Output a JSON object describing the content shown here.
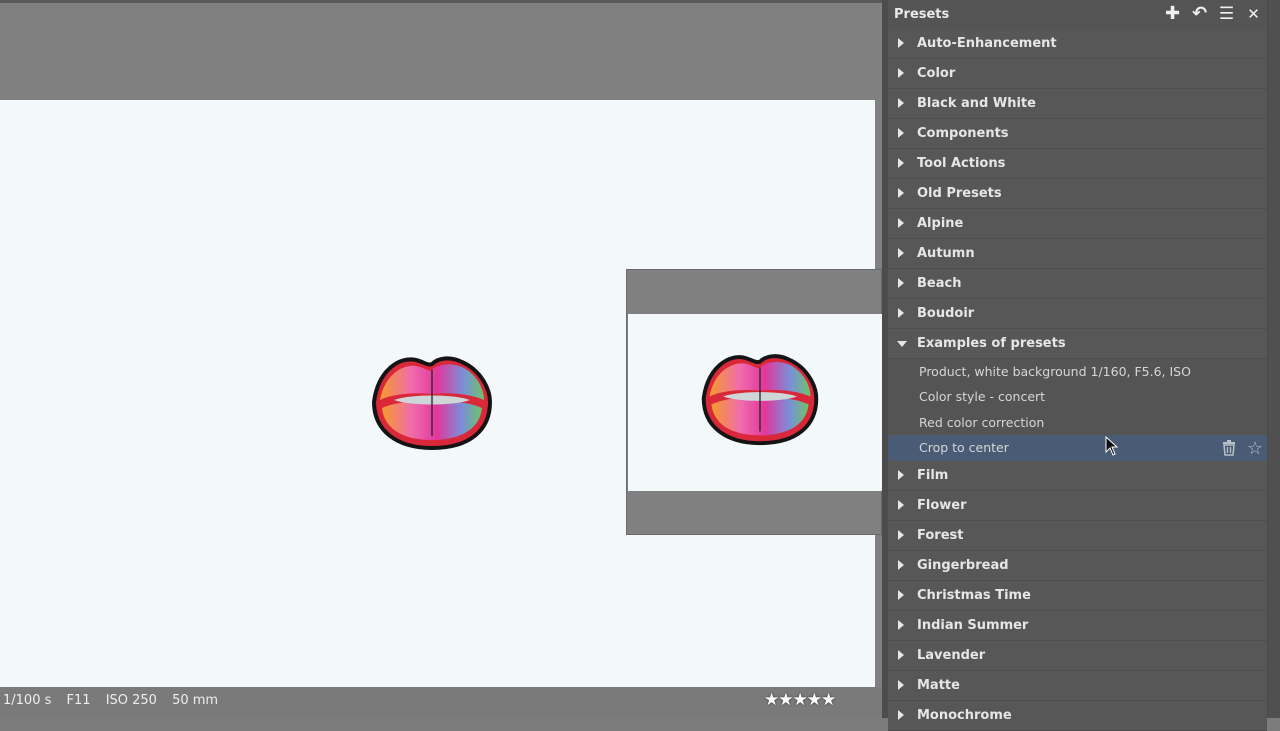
{
  "status": {
    "exif": [
      "1/100 s",
      "F11",
      "ISO 250",
      "50 mm"
    ],
    "rating": 5,
    "stars": "★★★★★"
  },
  "panel": {
    "title": "Presets",
    "icons": {
      "add": "plus-icon",
      "undo": "undo-icon",
      "menu": "menu-icon",
      "close": "close-icon"
    },
    "glyphs": {
      "add": "✚",
      "undo": "↶",
      "menu": "☰",
      "close": "✕",
      "delete": "🗑",
      "favorite": "☆"
    },
    "categories_before": [
      "Auto-Enhancement",
      "Color",
      "Black and White",
      "Components",
      "Tool Actions",
      "Old Presets",
      "Alpine",
      "Autumn",
      "Beach",
      "Boudoir"
    ],
    "open_category": "Examples of presets",
    "presets": [
      "Product, white background 1/160, F5.6, ISO",
      "Color style - concert",
      "Red color correction",
      "Crop to center"
    ],
    "selected_preset": "Crop to center",
    "categories_after": [
      "Film",
      "Flower",
      "Forest",
      "Gingerbread",
      "Christmas Time",
      "Indian Summer",
      "Lavender",
      "Matte",
      "Monochrome"
    ]
  },
  "colors": {
    "selection": "#4a5b75",
    "panel_bg": "#545454",
    "canvas_bg": "#808080"
  }
}
